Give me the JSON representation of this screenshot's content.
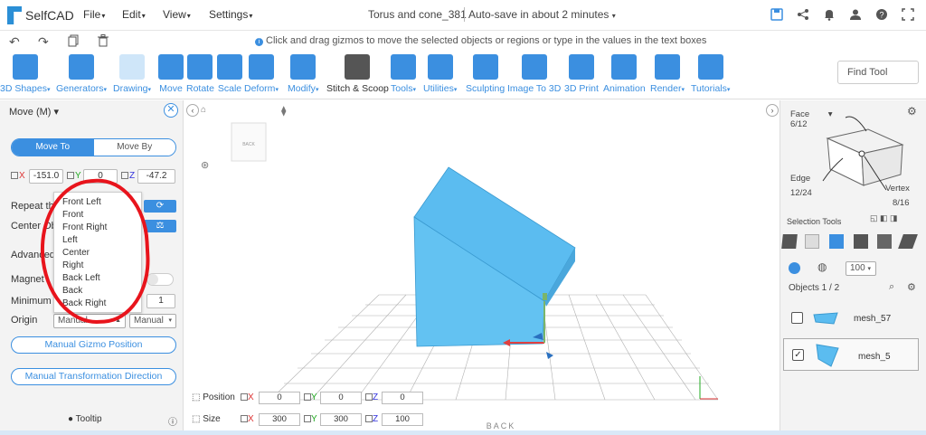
{
  "app": {
    "name": "SelfCAD",
    "menus": [
      "File",
      "Edit",
      "View",
      "Settings"
    ],
    "doc_title": "Torus and cone_381",
    "autosave": "Auto-save in about 2 minutes"
  },
  "hint": "Click and drag gizmos to move the selected objects or regions or type in the values in the text boxes",
  "toolbar": [
    {
      "label": "3D Shapes",
      "caret": true,
      "dark": false
    },
    {
      "label": "Generators",
      "caret": true,
      "dark": false
    },
    {
      "label": "Drawing",
      "caret": true,
      "dark": false
    },
    {
      "label": "Move",
      "caret": false,
      "dark": false
    },
    {
      "label": "Rotate",
      "caret": false,
      "dark": false
    },
    {
      "label": "Scale",
      "caret": false,
      "dark": false
    },
    {
      "label": "Deform",
      "caret": true,
      "dark": false
    },
    {
      "label": "Modify",
      "caret": true,
      "dark": false
    },
    {
      "label": "Stitch & Scoop",
      "caret": false,
      "dark": true
    },
    {
      "label": "Tools",
      "caret": true,
      "dark": false
    },
    {
      "label": "Utilities",
      "caret": true,
      "dark": false
    },
    {
      "label": "Sculpting",
      "caret": false,
      "dark": false
    },
    {
      "label": "Image To 3D",
      "caret": false,
      "dark": false
    },
    {
      "label": "3D Print",
      "caret": false,
      "dark": false
    },
    {
      "label": "Animation",
      "caret": false,
      "dark": false
    },
    {
      "label": "Render",
      "caret": true,
      "dark": false
    },
    {
      "label": "Tutorials",
      "caret": true,
      "dark": false
    }
  ],
  "find_tool": "Find Tool",
  "left": {
    "title": "Move (M)",
    "mode_to": "Move To",
    "mode_by": "Move By",
    "x": "-151.0",
    "y": "0",
    "z": "-47.2",
    "repeat_label": "Repeat the",
    "center_label": "Center Ob",
    "advanced_label": "Advanced",
    "magnet_label": "Magnet",
    "minimum_label": "Minimum",
    "minimum_value": "1",
    "origin_label": "Origin",
    "origin_value": "Manual",
    "origin_value2": "Manual",
    "btn_gizmo": "Manual Gizmo Position",
    "btn_transform": "Manual Transformation Direction",
    "tooltip": "Tooltip"
  },
  "dropdown": [
    "Front Left",
    "Front",
    "Front Right",
    "Left",
    "Center",
    "Right",
    "Back Left",
    "Back",
    "Back Right"
  ],
  "viewport": {
    "cube_label": "BACK",
    "ground_label": "BACK",
    "position_label": "Position",
    "size_label": "Size",
    "pos": [
      "0",
      "0",
      "0"
    ],
    "size": [
      "300",
      "300",
      "100"
    ]
  },
  "right": {
    "face": "Face",
    "face_count": "6/12",
    "edge": "Edge",
    "edge_count": "12/24",
    "vertex": "Vertex",
    "vertex_count": "8/16",
    "selection_tools": "Selection Tools",
    "opacity": "100",
    "objects": "Objects 1 / 2",
    "obj1": "mesh_57",
    "obj2": "mesh_5"
  },
  "colors": {
    "accent": "#3b8fe0",
    "object": "#5bbcf0",
    "highlight": "#e8141c"
  }
}
